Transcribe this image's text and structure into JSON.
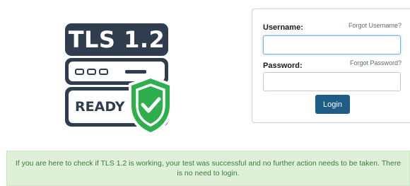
{
  "logo": {
    "title": "TLS 1.2",
    "status": "READY",
    "colors": {
      "server": "#2f3d4f",
      "shield": "#2fae4e",
      "shield_light": "#ffffff"
    },
    "icon": "shield-check-icon"
  },
  "login": {
    "username_label": "Username:",
    "forgot_username": "Forgot Username?",
    "username_value": "",
    "password_label": "Password:",
    "forgot_password": "Forgot Password?",
    "password_value": "",
    "button_label": "Login",
    "button_color": "#1d5d88"
  },
  "notice": {
    "text": "If you are here to check if TLS 1.2 is working, your test was successful and no further action needs to be taken. There is no need to login.",
    "background": "#dff0d8",
    "text_color": "#3c7a3c"
  }
}
